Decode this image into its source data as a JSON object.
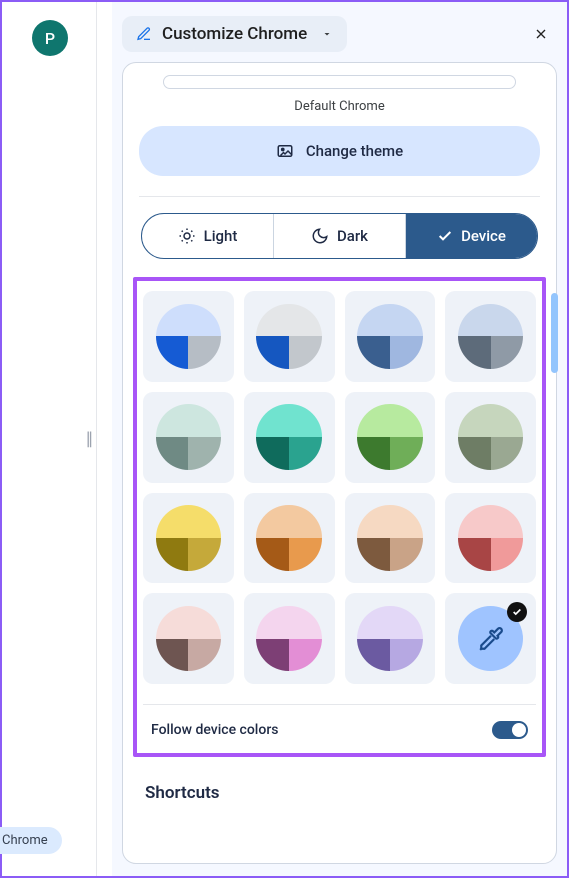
{
  "avatar": {
    "initial": "P"
  },
  "left_chip": {
    "label": "Chrome"
  },
  "header": {
    "title": "Customize Chrome"
  },
  "theme": {
    "caption": "Default Chrome",
    "change_label": "Change theme"
  },
  "modes": {
    "light": "Light",
    "dark": "Dark",
    "device": "Device",
    "active": "device"
  },
  "swatches": [
    {
      "top": "#cedefc",
      "bl": "#155bd4",
      "br": "#b6bdc5"
    },
    {
      "top": "#e4e6e8",
      "bl": "#1557c0",
      "br": "#c2c7cc"
    },
    {
      "top": "#c5d6f2",
      "bl": "#3a5f8f",
      "br": "#9fb7e0"
    },
    {
      "top": "#c9d7ec",
      "bl": "#5d6b7a",
      "br": "#8f9aa6"
    },
    {
      "top": "#cde6df",
      "bl": "#6f8a84",
      "br": "#9fb3ad"
    },
    {
      "top": "#70e3cf",
      "bl": "#0f6b5c",
      "br": "#2aa38f"
    },
    {
      "top": "#b7ea9f",
      "bl": "#3d7a2e",
      "br": "#6fae58"
    },
    {
      "top": "#c6d6bd",
      "bl": "#6e7d65",
      "br": "#9aa892"
    },
    {
      "top": "#f5dd6a",
      "bl": "#8f7a10",
      "br": "#c5a93a"
    },
    {
      "top": "#f3c9a0",
      "bl": "#a55a17",
      "br": "#e89a4d"
    },
    {
      "top": "#f6d9c2",
      "bl": "#7d5a3e",
      "br": "#c9a387"
    },
    {
      "top": "#f7c9c9",
      "bl": "#a84545",
      "br": "#f09a9a"
    },
    {
      "top": "#f6dcd9",
      "bl": "#6e5551",
      "br": "#c7a9a3"
    },
    {
      "top": "#f4d5ee",
      "bl": "#7d3f75",
      "br": "#e38ed5"
    },
    {
      "top": "#e3d8f7",
      "bl": "#6b5aa1",
      "br": "#b6a8e2"
    }
  ],
  "follow": {
    "label": "Follow device colors",
    "on": true
  },
  "shortcuts": {
    "title": "Shortcuts"
  }
}
